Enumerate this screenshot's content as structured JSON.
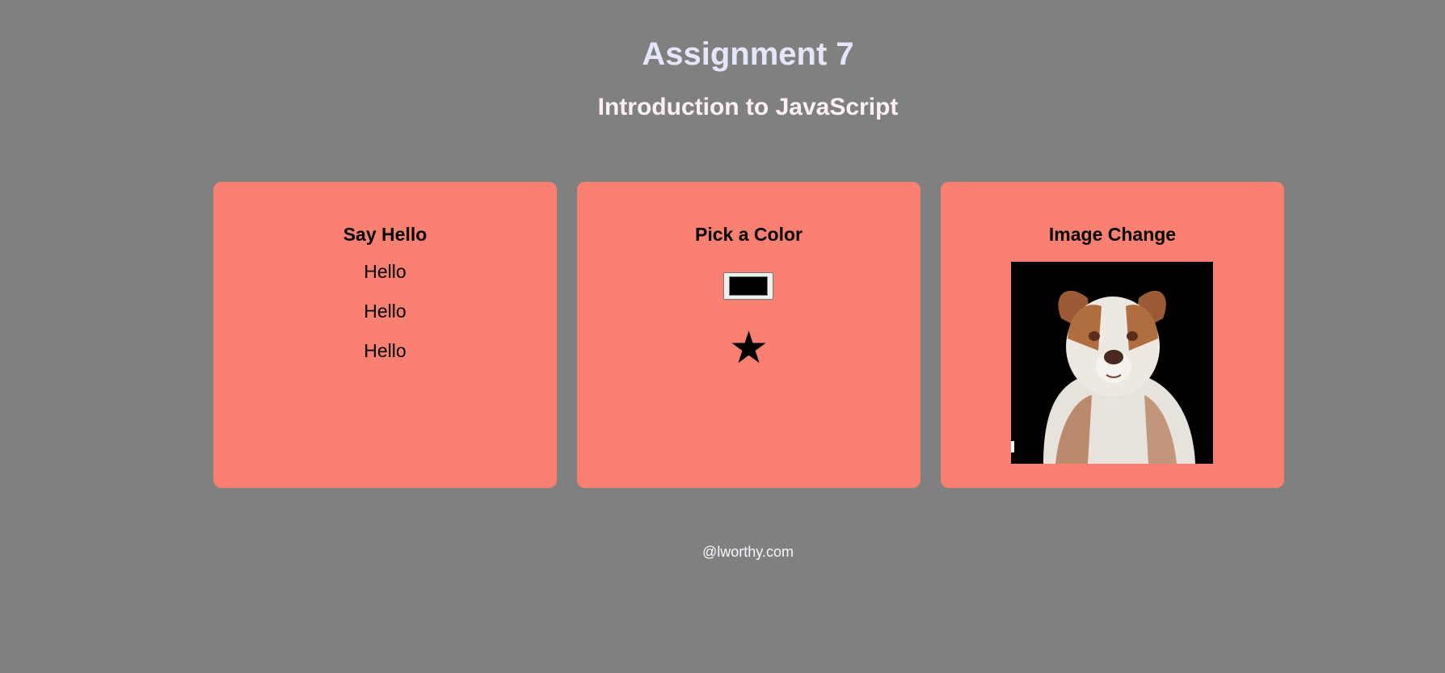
{
  "header": {
    "title": "Assignment 7",
    "subtitle": "Introduction to JavaScript"
  },
  "cards": [
    {
      "title": "Say Hello",
      "items": [
        "Hello",
        "Hello",
        "Hello"
      ]
    },
    {
      "title": "Pick a Color",
      "color_value": "#000000",
      "star": "★"
    },
    {
      "title": "Image Change",
      "image_icon": "dog-photo"
    }
  ],
  "footer": {
    "text": "@lworthy.com"
  },
  "colors": {
    "background": "#808080",
    "card": "#fa8072",
    "title": "#e6e6fa",
    "subtitle": "#fff0f5"
  }
}
